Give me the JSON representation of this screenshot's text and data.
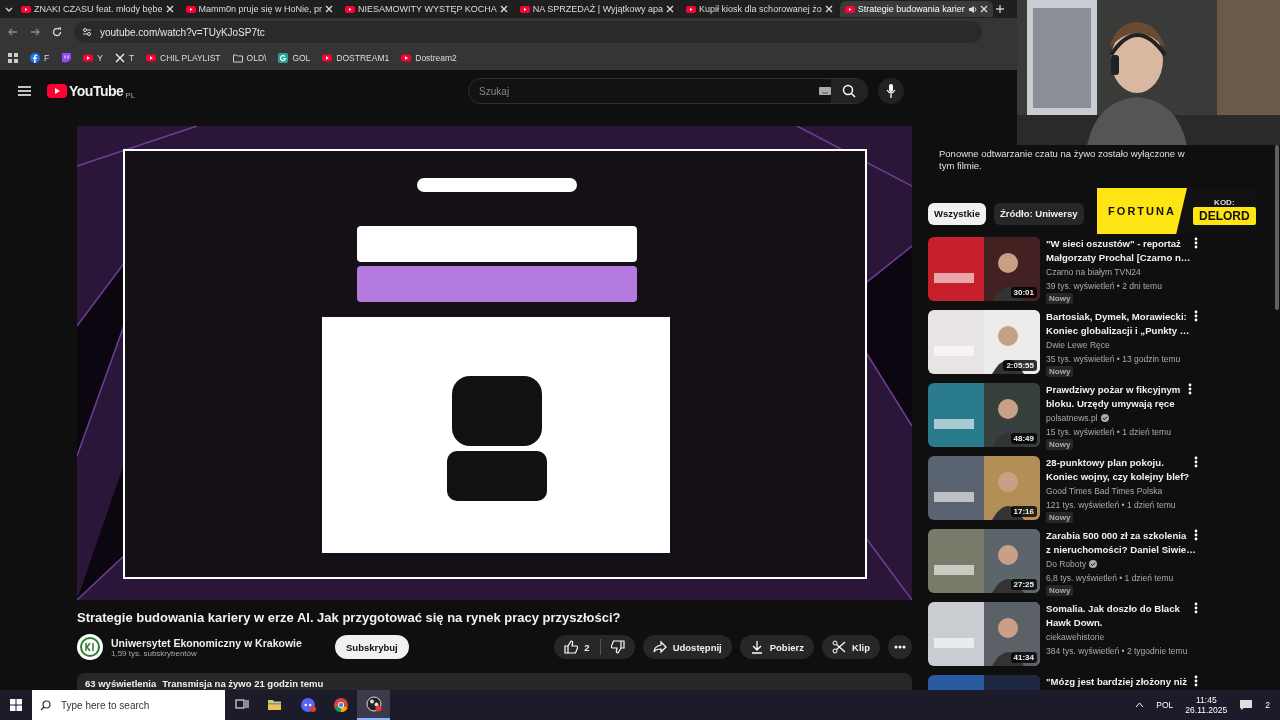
{
  "browser": {
    "tabs": [
      {
        "title": "ZNAKI CZASU feat. młody bębe",
        "selected": false,
        "audio": false
      },
      {
        "title": "Mamm0n pruje się w HoNie, pr",
        "selected": false,
        "audio": false
      },
      {
        "title": "NIESAMOWITY WYSTĘP KOCHA",
        "selected": false,
        "audio": false
      },
      {
        "title": "NA SPRZEDAŻ | Wyjątkowy apa",
        "selected": false,
        "audio": false
      },
      {
        "title": "Kupił kiosk dla schorowanej żo",
        "selected": false,
        "audio": false
      },
      {
        "title": "Strategie budowania karier",
        "selected": true,
        "audio": true
      }
    ],
    "url": "youtube.com/watch?v=TUyKJoSP7tc",
    "bookmarks": [
      {
        "kind": "facebook",
        "label": "F"
      },
      {
        "kind": "twitch"
      },
      {
        "kind": "youtube",
        "label": "Y"
      },
      {
        "kind": "x",
        "label": "T"
      },
      {
        "kind": "youtube",
        "label": "CHIL PLAYLIST"
      },
      {
        "kind": "folder",
        "label": "OLD\\"
      },
      {
        "kind": "g",
        "label": "GOL"
      },
      {
        "kind": "youtube",
        "label": "DOSTREAM1"
      },
      {
        "kind": "youtube",
        "label": "Dostream2"
      }
    ]
  },
  "header": {
    "logo": "YouTube",
    "region": "PL",
    "search": {
      "placeholder": "Szukaj"
    }
  },
  "video": {
    "kind": "picture",
    "title": "Strategie budowania kariery w erze AI. Jak przygotować się na rynek pracy przyszłości?",
    "channel": "Uniwersytet Ekonomiczny w Krakowie",
    "subscribers": "1,59 tys. subskrybentów",
    "subscribe": "Subskrybuj",
    "likes": "2",
    "actions": [
      {
        "kind": "share",
        "label": "Udostępnij"
      },
      {
        "kind": "download",
        "label": "Pobierz"
      },
      {
        "kind": "clip",
        "label": "Klip"
      }
    ],
    "views": "63 wyświetlenia",
    "published": "Transmisja na żywo 21 godzin temu"
  },
  "chat_notice": "Ponowne odtwarzanie czatu na żywo zostało wyłączone w tym filmie.",
  "chips": [
    {
      "label": "Wszystkie",
      "selected": true
    },
    {
      "label": "Źródło: Uniwersy",
      "selected": false
    }
  ],
  "related": [
    {
      "title_lines": [
        "\"W sieci oszustów\" - reportaż",
        "Małgorzaty Prochal [Czarno n…"
      ],
      "channel": "Czarno na białym TVN24",
      "verified": false,
      "meta": "39 tys. wyświetleń • 2 dni temu",
      "badge": "Nowy",
      "duration": "30:01",
      "color": "#c8202a"
    },
    {
      "title_lines": [
        "Bartosiak, Dymek, Morawiecki:",
        "Koniec globalizacji i „Punkty …"
      ],
      "channel": "Dwie Lewe Ręce",
      "verified": false,
      "meta": "35 tys. wyświetleń • 13 godzin temu",
      "badge": "Nowy",
      "duration": "2:05:55",
      "color": "#e8e4e4"
    },
    {
      "title_lines": [
        "Prawdziwy pożar w fikcyjnym",
        "bloku. Urzędy umywają ręce"
      ],
      "channel": "polsatnews.pl",
      "verified": true,
      "meta": "15 tys. wyświetleń • 1 dzień temu",
      "badge": "Nowy",
      "duration": "48:49",
      "color": "#2a7c8c"
    },
    {
      "title_lines": [
        "28-punktowy plan pokoju.",
        "Koniec wojny, czy kolejny blef?"
      ],
      "channel": "Good Times Bad Times Polska",
      "verified": false,
      "meta": "121 tys. wyświetleń • 1 dzień temu",
      "badge": "Nowy",
      "duration": "17:16",
      "color": "#5a6470"
    },
    {
      "title_lines": [
        "Zarabia 500 000 zł za szkolenia",
        "z nieruchomości? Daniel Siwie…"
      ],
      "channel": "Do Roboty",
      "verified": true,
      "meta": "6,8 tys. wyświetleń • 1 dzień temu",
      "badge": "Nowy",
      "duration": "27:25",
      "color": "#7a7a6a"
    },
    {
      "title_lines": [
        "Somalia. Jak doszło do Black",
        "Hawk Down."
      ],
      "channel": "ciekawehistorie",
      "verified": false,
      "meta": "384 tys. wyświetleń • 2 tygodnie temu",
      "duration": "41:34",
      "color": "#c9ccd0"
    },
    {
      "title_lines": [
        "\"Mózg jest bardziej złożony niż"
      ],
      "color": "#2a5aa0"
    }
  ],
  "overlay": {
    "brand": "FORTUNA",
    "code_label": "KOD:",
    "code": "DELORD"
  },
  "taskbar": {
    "search": {
      "placeholder": "Type here to search"
    },
    "apps": [
      {
        "kind": "taskview",
        "active": false
      },
      {
        "kind": "explorer",
        "active": false
      },
      {
        "kind": "discord",
        "active": false
      },
      {
        "kind": "chrome",
        "active": false
      },
      {
        "kind": "obs",
        "active": true
      }
    ],
    "language": "POL",
    "time": "11:45",
    "date": "26.11.2025",
    "notifications": "2"
  }
}
